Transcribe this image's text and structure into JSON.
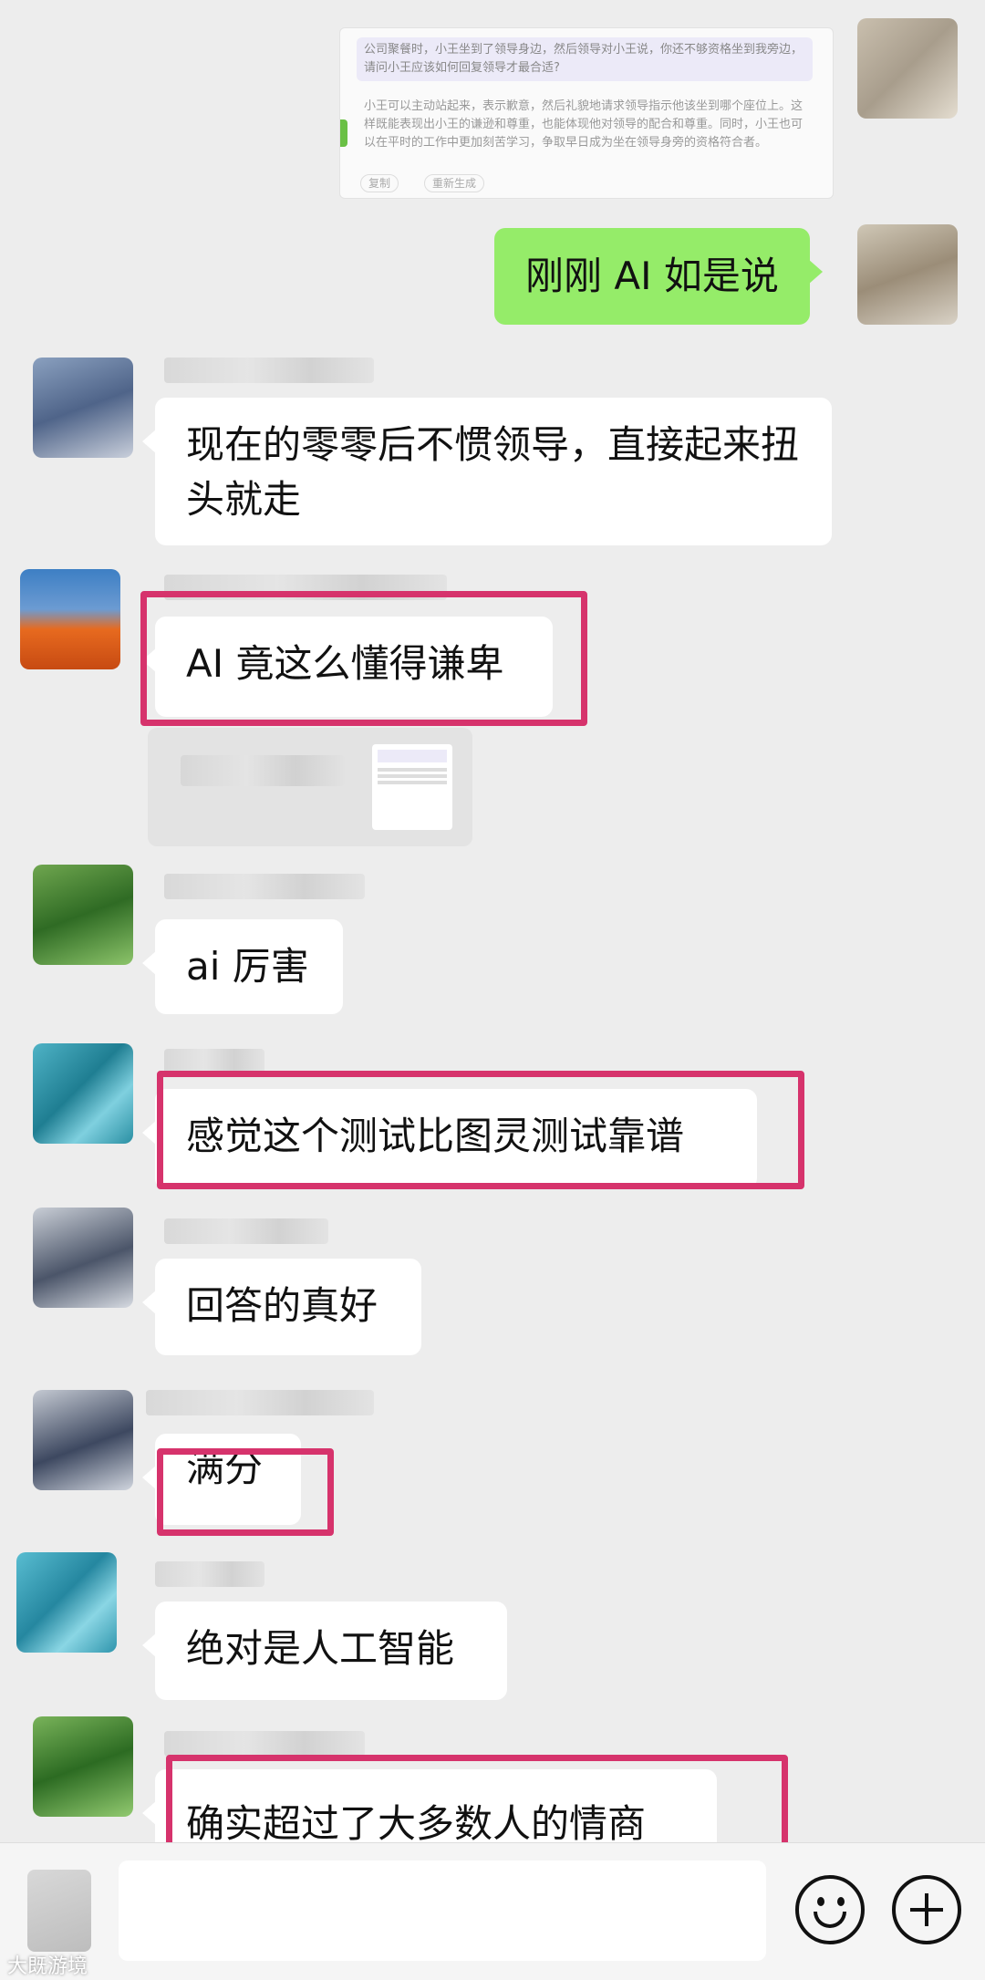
{
  "top_screenshot": {
    "question": "公司聚餐时，小王坐到了领导身边，然后领导对小王说，你还不够资格坐到我旁边，请问小王应该如何回复领导才最合适?",
    "answer": "小王可以主动站起来，表示歉意，然后礼貌地请求领导指示他该坐到哪个座位上。这样既能表现出小王的谦逊和尊重，也能体现他对领导的配合和尊重。同时，小王也可以在平时的工作中更加刻苦学习，争取早日成为坐在领导身旁的资格符合者。",
    "actions": [
      "复制",
      "重新生成"
    ]
  },
  "messages": [
    {
      "id": "m1",
      "sender": "me",
      "text": "刚刚 AI 如是说"
    },
    {
      "id": "m2",
      "sender": "other",
      "text": "现在的零零后不惯领导，直接起来扭头就走"
    },
    {
      "id": "m3",
      "sender": "other",
      "text": "AI 竟这么懂得谦卑",
      "highlighted": true
    },
    {
      "id": "m3b",
      "sender": "other",
      "type": "image-share"
    },
    {
      "id": "m4",
      "sender": "other",
      "text": "ai 厉害"
    },
    {
      "id": "m5",
      "sender": "other",
      "text": "感觉这个测试比图灵测试靠谱",
      "highlighted": true
    },
    {
      "id": "m6",
      "sender": "other",
      "text": "回答的真好"
    },
    {
      "id": "m7",
      "sender": "other",
      "text": "满分",
      "highlighted": true
    },
    {
      "id": "m8",
      "sender": "other",
      "text": "绝对是人工智能"
    },
    {
      "id": "m9",
      "sender": "other",
      "text": "确实超过了大多数人的情商",
      "highlighted": true
    }
  ],
  "bottom_bar": {
    "emoji_icon": "smiley-icon",
    "plus_icon": "plus-icon",
    "voice_icon": "voice-icon"
  },
  "watermark": "大既游境",
  "colors": {
    "background": "#ededed",
    "my_bubble": "#95ec69",
    "highlight": "#d6336c"
  }
}
